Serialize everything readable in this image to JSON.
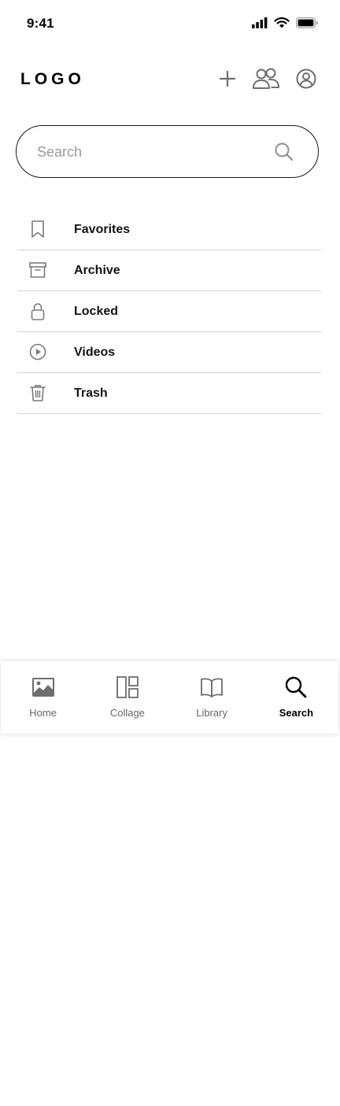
{
  "status_bar": {
    "time": "9:41",
    "icons": [
      "cellular-signal-icon",
      "wifi-icon",
      "battery-icon"
    ]
  },
  "header": {
    "logo_text": "LOGO",
    "actions": [
      "plus-icon",
      "people-icon",
      "account-icon"
    ]
  },
  "search": {
    "placeholder": "Search",
    "value": ""
  },
  "menu": {
    "items": [
      {
        "label": "Favorites",
        "icon": "bookmark-icon"
      },
      {
        "label": "Archive",
        "icon": "archive-box-icon"
      },
      {
        "label": "Locked",
        "icon": "lock-icon"
      },
      {
        "label": "Videos",
        "icon": "play-circle-icon"
      },
      {
        "label": "Trash",
        "icon": "trash-icon"
      }
    ]
  },
  "tab_bar": {
    "tabs": [
      {
        "label": "Home",
        "icon": "image-icon",
        "active": false
      },
      {
        "label": "Collage",
        "icon": "collage-icon",
        "active": false
      },
      {
        "label": "Library",
        "icon": "book-icon",
        "active": false
      },
      {
        "label": "Search",
        "icon": "search-icon",
        "active": true
      }
    ]
  },
  "colors": {
    "text": "#111111",
    "icon_gray": "#7a7a7a",
    "divider": "#d4d4d4",
    "border": "#1a1a1a",
    "placeholder": "#9a9a9a"
  }
}
